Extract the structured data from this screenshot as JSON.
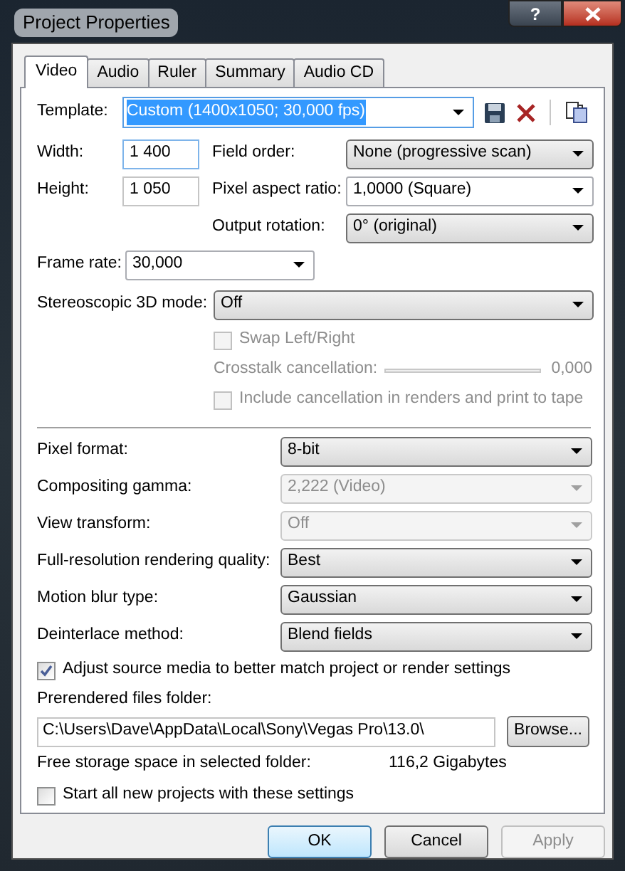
{
  "window": {
    "title": "Project Properties",
    "help": "?"
  },
  "tabs": [
    {
      "label": "Video",
      "selected": true
    },
    {
      "label": "Audio",
      "selected": false
    },
    {
      "label": "Ruler",
      "selected": false
    },
    {
      "label": "Summary",
      "selected": false
    },
    {
      "label": "Audio CD",
      "selected": false
    }
  ],
  "template": {
    "label": "Template:",
    "value": "Custom (1400x1050; 30,000 fps)",
    "text_selected": true
  },
  "size_fields": [
    {
      "label": "Width:",
      "value": "1 400",
      "focused": true
    },
    {
      "label": "Height:",
      "value": "1 050",
      "focused": false
    }
  ],
  "video_dropdowns": [
    {
      "label": "Field order:",
      "value": "None (progressive scan)",
      "kind": "list"
    },
    {
      "label": "Pixel aspect ratio:",
      "value": "1,0000 (Square)",
      "kind": "combo"
    },
    {
      "label": "Output rotation:",
      "value": "0° (original)",
      "kind": "list"
    }
  ],
  "frame_rate": {
    "label": "Frame rate:",
    "value": "30,000"
  },
  "stereo": {
    "label": "Stereoscopic 3D mode:",
    "value": "Off"
  },
  "swap": {
    "label": "Swap Left/Right",
    "checked": false,
    "disabled": true
  },
  "crosstalk": {
    "label": "Crosstalk cancellation:",
    "reading": "0,000",
    "level": 0,
    "disabled": true
  },
  "include": {
    "label": "Include cancellation in renders and print to tape",
    "checked": false,
    "disabled": true
  },
  "settings": [
    {
      "label": "Pixel format:",
      "value": "8-bit",
      "disabled": false
    },
    {
      "label": "Compositing gamma:",
      "value": "2,222 (Video)",
      "disabled": true
    },
    {
      "label": "View transform:",
      "value": "Off",
      "disabled": true
    },
    {
      "label": "Full-resolution rendering quality:",
      "value": "Best",
      "disabled": false
    },
    {
      "label": "Motion blur type:",
      "value": "Gaussian",
      "disabled": false
    },
    {
      "label": "Deinterlace method:",
      "value": "Blend fields",
      "disabled": false
    }
  ],
  "adjust": {
    "label": "Adjust source media to better match project or render settings",
    "checked": true,
    "disabled": false
  },
  "folder": {
    "label": "Prerendered files folder:",
    "value": "C:\\Users\\Dave\\AppData\\Local\\Sony\\Vegas Pro\\13.0\\",
    "browse": "Browse..."
  },
  "storage": {
    "label": "Free storage space in selected folder:",
    "value": "116,2 Gigabytes"
  },
  "start": {
    "label": "Start all new projects with these settings",
    "checked": false,
    "disabled": false
  },
  "buttons": [
    {
      "label": "OK",
      "default": true,
      "disabled": false
    },
    {
      "label": "Cancel",
      "default": false,
      "disabled": false
    },
    {
      "label": "Apply",
      "default": false,
      "disabled": true
    }
  ]
}
